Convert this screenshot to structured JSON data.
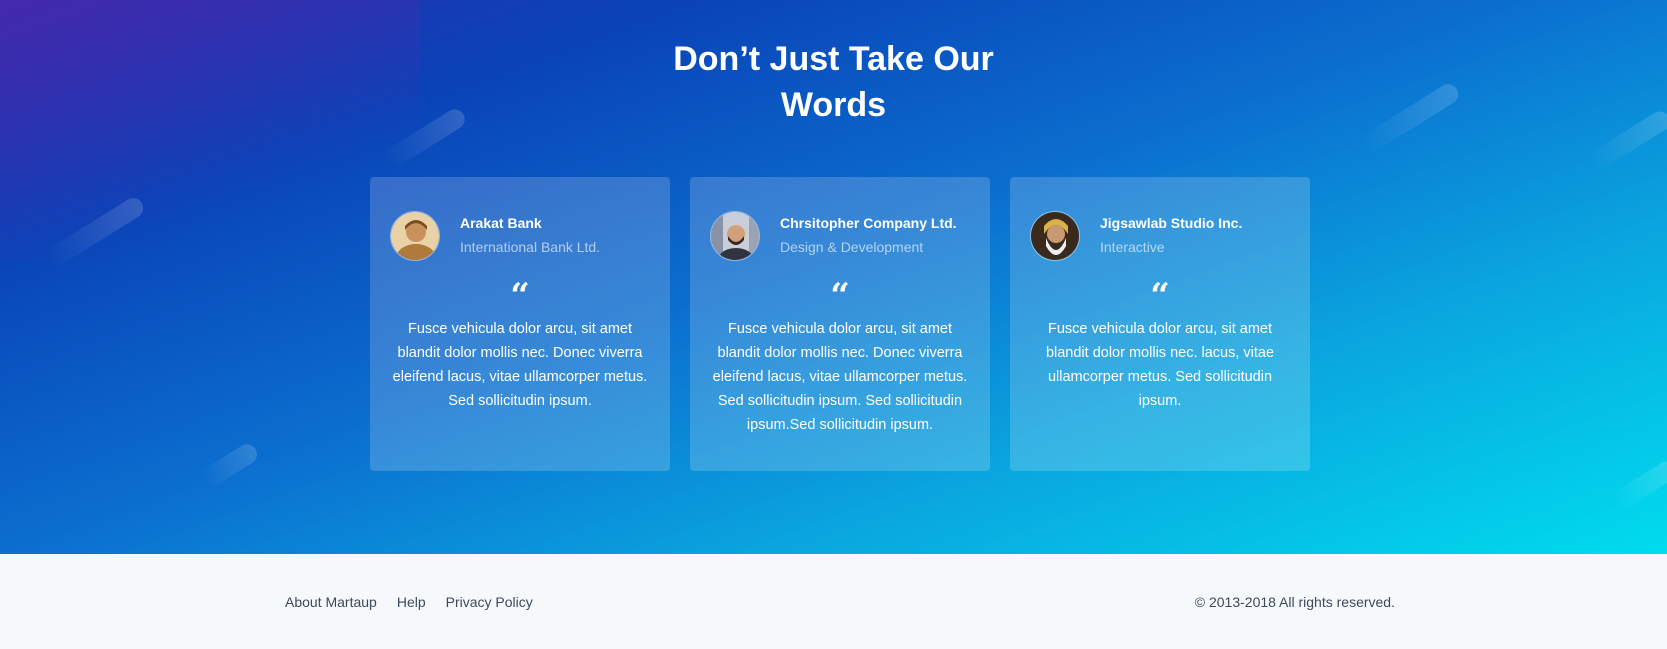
{
  "section": {
    "title": "Don’t Just Take Our Words"
  },
  "testimonials": [
    {
      "name": "Arakat Bank",
      "role": "International Bank Ltd.",
      "quote_mark": "“",
      "text": "Fusce vehicula dolor arcu, sit amet blandit dolor mollis nec. Donec viverra eleifend lacus, vitae ullamcorper metus. Sed sollicitudin ipsum."
    },
    {
      "name": "Chrsitopher Company Ltd.",
      "role": "Design & Development",
      "quote_mark": "“",
      "text": "Fusce vehicula dolor arcu, sit amet blandit dolor mollis nec. Donec viverra eleifend lacus, vitae ullamcorper metus. Sed sollicitudin ipsum. Sed sollicitudin ipsum.Sed sollicitudin ipsum."
    },
    {
      "name": "Jigsawlab Studio Inc.",
      "role": "Interactive",
      "quote_mark": "“",
      "text": "Fusce vehicula dolor arcu, sit amet blandit dolor mollis nec. lacus, vitae ullamcorper metus. Sed sollicitudin ipsum."
    }
  ],
  "footer": {
    "links": [
      "About Martaup",
      "Help",
      "Privacy Policy"
    ],
    "copyright": "© 2013-2018 All rights reserved."
  },
  "colors": {
    "gradient_start": "#2a2bb0",
    "gradient_mid": "#0b6fcf",
    "gradient_end": "#00dcee",
    "footer_bg": "#f5f9fc"
  }
}
